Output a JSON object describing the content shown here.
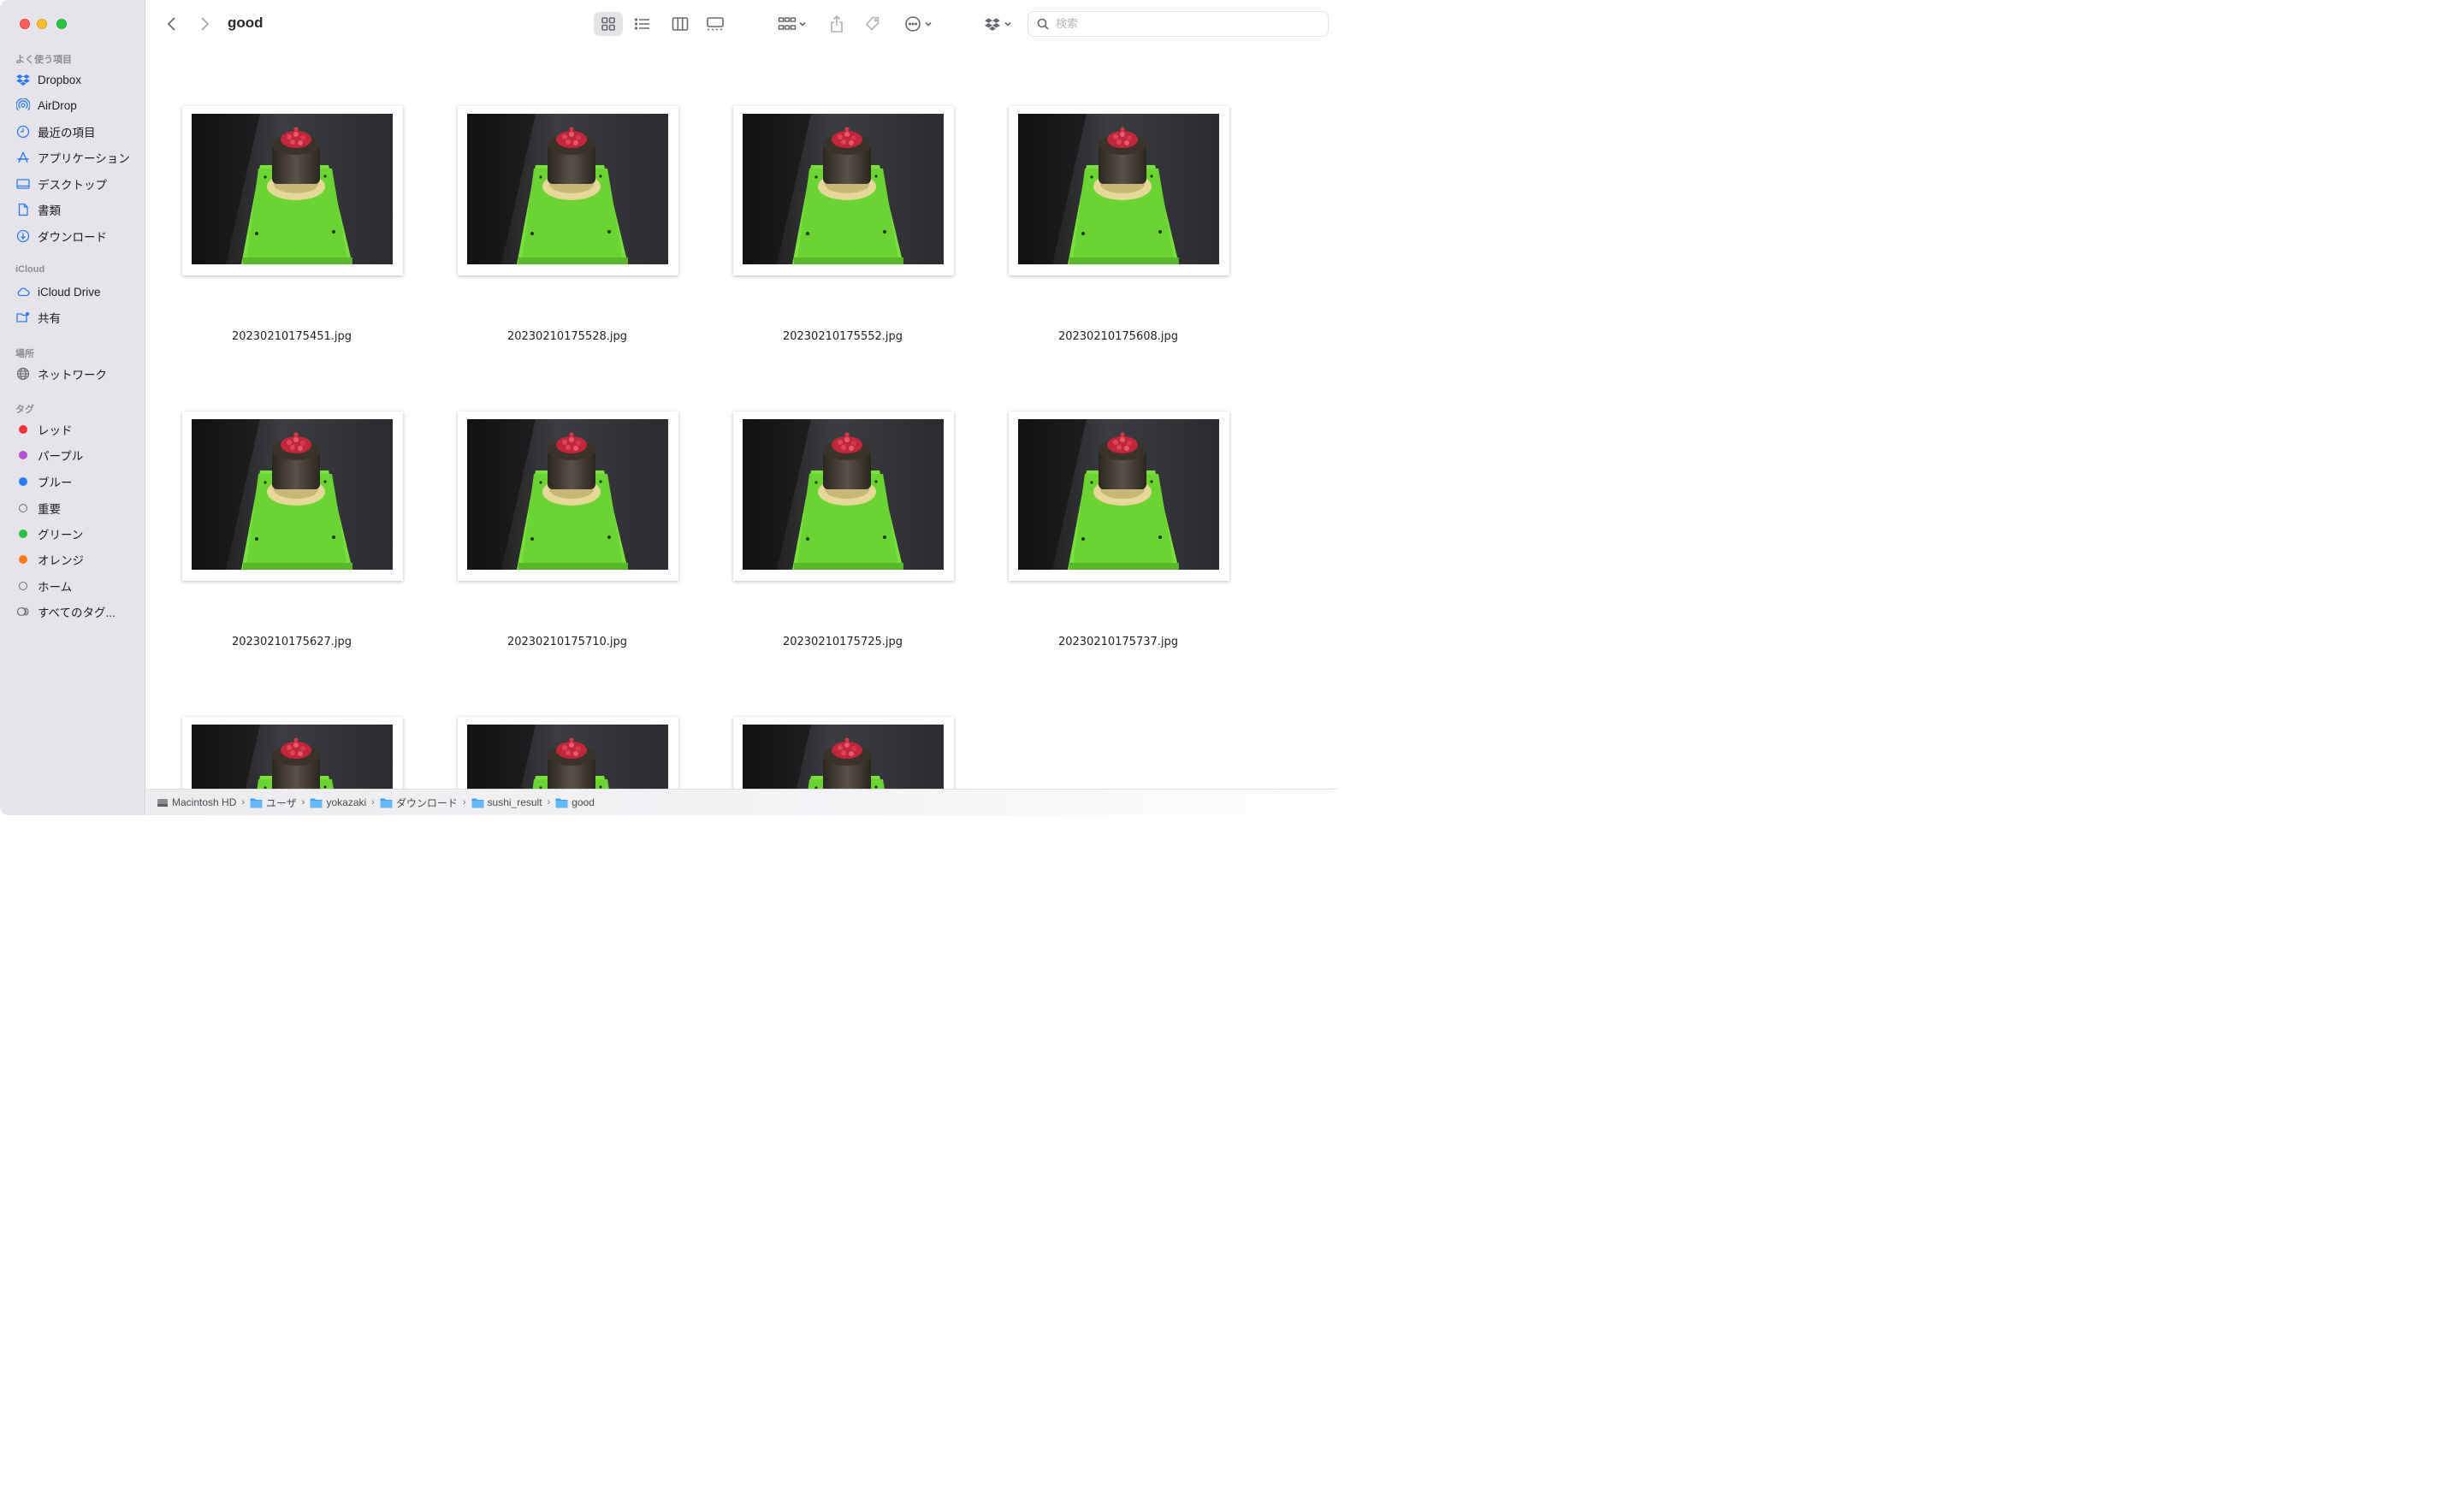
{
  "window": {
    "title": "good"
  },
  "sidebar": {
    "sections": [
      {
        "title": "よく使う項目",
        "items": [
          {
            "label": "Dropbox",
            "icon": "dropbox-icon"
          },
          {
            "label": "AirDrop",
            "icon": "airdrop-icon"
          },
          {
            "label": "最近の項目",
            "icon": "clock-icon"
          },
          {
            "label": "アプリケーション",
            "icon": "applications-icon"
          },
          {
            "label": "デスクトップ",
            "icon": "desktop-icon"
          },
          {
            "label": "書類",
            "icon": "document-icon"
          },
          {
            "label": "ダウンロード",
            "icon": "download-icon"
          }
        ]
      },
      {
        "title": "iCloud",
        "items": [
          {
            "label": "iCloud Drive",
            "icon": "cloud-icon"
          },
          {
            "label": "共有",
            "icon": "shared-folder-icon"
          }
        ]
      },
      {
        "title": "場所",
        "items": [
          {
            "label": "ネットワーク",
            "icon": "network-icon"
          }
        ]
      },
      {
        "title": "タグ",
        "items": [
          {
            "label": "レッド",
            "color": "#f5303a"
          },
          {
            "label": "パープル",
            "color": "#b153d4"
          },
          {
            "label": "ブルー",
            "color": "#2a7bf4"
          },
          {
            "label": "重要",
            "color": ""
          },
          {
            "label": "グリーン",
            "color": "#2cbf40"
          },
          {
            "label": "オレンジ",
            "color": "#fa7a1c"
          },
          {
            "label": "ホーム",
            "color": ""
          },
          {
            "label": "すべてのタグ...",
            "color": ""
          }
        ]
      }
    ]
  },
  "toolbar": {
    "search_placeholder": "検索"
  },
  "files": [
    "20230210175451.jpg",
    "20230210175528.jpg",
    "20230210175552.jpg",
    "20230210175608.jpg",
    "20230210175627.jpg",
    "20230210175710.jpg",
    "20230210175725.jpg",
    "20230210175737.jpg",
    "",
    "",
    ""
  ],
  "pathbar": [
    "Macintosh HD",
    "ユーザ",
    "yokazaki",
    "ダウンロード",
    "sushi_result",
    "good"
  ],
  "colors": {
    "sidebar_bg": "#e6e3ea",
    "accent": "#2a7bf4",
    "tray_green": "#76e83a"
  }
}
